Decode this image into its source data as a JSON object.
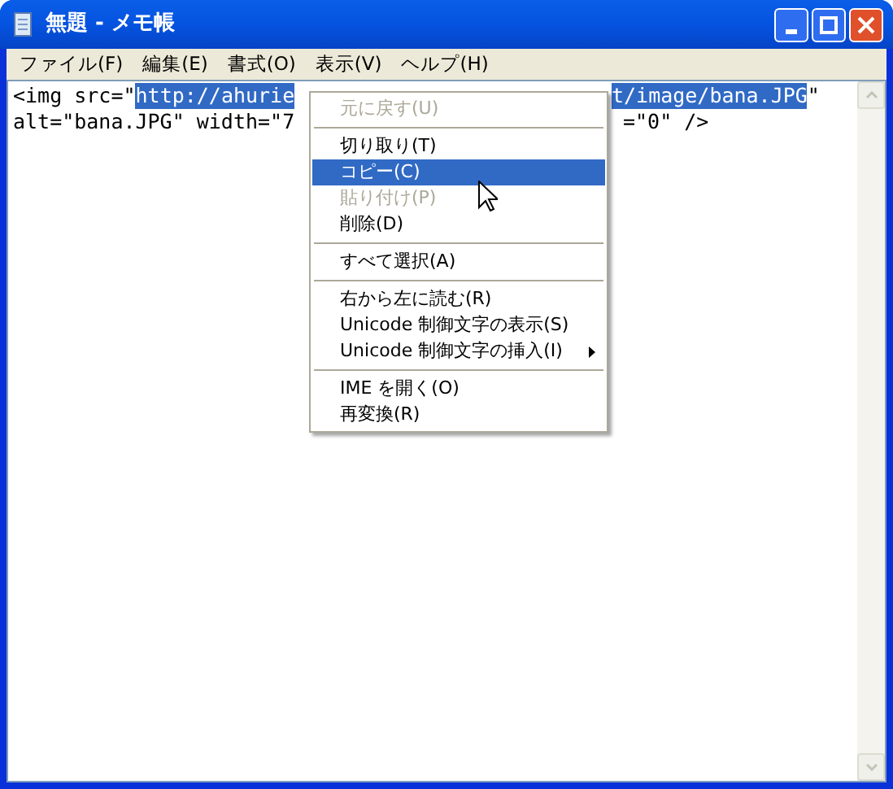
{
  "window": {
    "title": "無題 - メモ帳"
  },
  "menu_bar": [
    "ファイル(F)",
    "編集(E)",
    "書式(O)",
    "表示(V)",
    "ヘルプ(H)"
  ],
  "editor": {
    "lines": [
      {
        "left": [
          {
            "text": "<img src=\"",
            "selected": false
          },
          {
            "text": "http://ahurie",
            "selected": true
          }
        ],
        "right": [
          {
            "text": "t/image/bana.JPG",
            "selected": true
          },
          {
            "text": "\"",
            "selected": false
          }
        ]
      },
      {
        "left": [
          {
            "text": "alt=\"bana.JPG\" width=\"7",
            "selected": false
          }
        ],
        "right": [
          {
            "text": "=\"0\" />",
            "selected": false
          }
        ]
      }
    ]
  },
  "context_menu": {
    "items": [
      {
        "kind": "item",
        "label": "元に戻す(U)",
        "disabled": true,
        "selected": false,
        "submenu": false
      },
      {
        "kind": "separator"
      },
      {
        "kind": "item",
        "label": "切り取り(T)",
        "disabled": false,
        "selected": false,
        "submenu": false
      },
      {
        "kind": "item",
        "label": "コピー(C)",
        "disabled": false,
        "selected": true,
        "submenu": false
      },
      {
        "kind": "item",
        "label": "貼り付け(P)",
        "disabled": true,
        "selected": false,
        "submenu": false
      },
      {
        "kind": "item",
        "label": "削除(D)",
        "disabled": false,
        "selected": false,
        "submenu": false
      },
      {
        "kind": "separator"
      },
      {
        "kind": "item",
        "label": "すべて選択(A)",
        "disabled": false,
        "selected": false,
        "submenu": false
      },
      {
        "kind": "separator"
      },
      {
        "kind": "item",
        "label": "右から左に読む(R)",
        "disabled": false,
        "selected": false,
        "submenu": false
      },
      {
        "kind": "item",
        "label": "Unicode 制御文字の表示(S)",
        "disabled": false,
        "selected": false,
        "submenu": false
      },
      {
        "kind": "item",
        "label": "Unicode 制御文字の挿入(I)",
        "disabled": false,
        "selected": false,
        "submenu": true
      },
      {
        "kind": "separator"
      },
      {
        "kind": "item",
        "label": "IME を開く(O)",
        "disabled": false,
        "selected": false,
        "submenu": false
      },
      {
        "kind": "item",
        "label": "再変換(R)",
        "disabled": false,
        "selected": false,
        "submenu": false
      }
    ]
  }
}
